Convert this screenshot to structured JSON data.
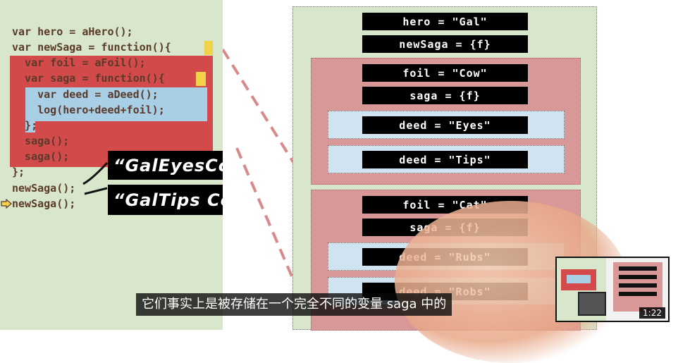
{
  "code": {
    "lines": [
      "var hero = aHero();",
      "var newSaga = function(){",
      "  var foil = aFoil();",
      "  var saga = function(){",
      "    var deed = aDeed();",
      "    log(hero+deed+foil);",
      "  };",
      "  saga();",
      "  saga();",
      "};",
      "newSaga();",
      "newSaga();"
    ]
  },
  "annotations": {
    "first_output": "“GalEyesCow”",
    "second_output": "“GalTips Cow”"
  },
  "scopes": {
    "global": {
      "hero": "hero = \"Gal\"",
      "newSaga": "newSaga = {f}"
    },
    "newSaga_1": {
      "foil": "foil = \"Cow\"",
      "saga": "saga = {f}",
      "saga_calls": [
        "deed = \"Eyes\"",
        "deed = \"Tips\""
      ]
    },
    "newSaga_2": {
      "foil": "foil = \"Cat\"",
      "saga": "saga = {f}",
      "saga_calls": [
        "deed = \"Rubs\"",
        "deed = \"Robs\""
      ]
    }
  },
  "subtitle": "它们事实上是被存储在一个完全不同的变量 saga 中的",
  "player": {
    "timestamp": "1:22"
  },
  "colors": {
    "code_bg": "#d8e6cc",
    "red_scope": "#d34a4a",
    "blue_scope": "#a9cfe6"
  }
}
